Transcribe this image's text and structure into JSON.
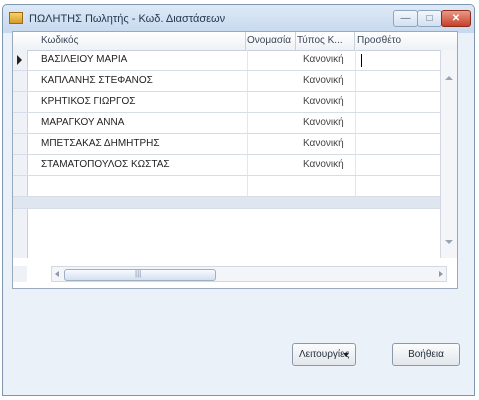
{
  "window": {
    "title": "ΠΩΛΗΤΗΣ Πωλητής - Κωδ. Διαστάσεων",
    "minimize_symbol": "—",
    "maximize_symbol": "□",
    "close_symbol": "✕"
  },
  "grid": {
    "columns": [
      "Κωδικός",
      "Ονομασία",
      "Τύπος Κ...",
      "Προσθέτο"
    ],
    "rows": [
      {
        "code": "ΒΑΣΙΛΕΙΟΥ ΜΑΡΙΑ",
        "type": "Κανονική"
      },
      {
        "code": "ΚΑΠΛΑΝΗΣ ΣΤΕΦΑΝΟΣ",
        "type": "Κανονική"
      },
      {
        "code": "ΚΡΗΤΙΚΟΣ ΓΙΩΡΓΟΣ",
        "type": "Κανονική"
      },
      {
        "code": "ΜΑΡΑΓΚΟΥ ΑΝΝΑ",
        "type": "Κανονική"
      },
      {
        "code": "ΜΠΕΤΣΑΚΑΣ ΔΗΜΗΤΡΗΣ",
        "type": "Κανονική"
      },
      {
        "code": "ΣΤΑΜΑΤΟΠΟΥΛΟΣ ΚΩΣΤΑΣ",
        "type": "Κανονική"
      }
    ],
    "hscroll_grip": "|||"
  },
  "buttons": {
    "functions": "Λειτουργίες",
    "help": "Βοήθεια"
  }
}
